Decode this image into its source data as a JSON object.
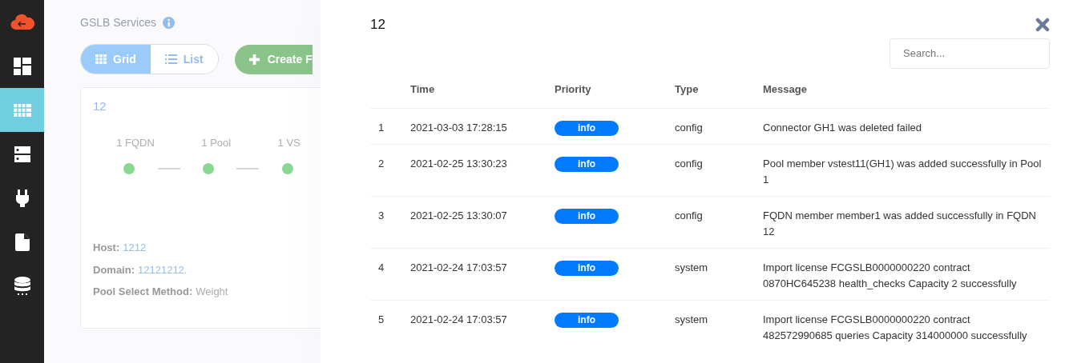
{
  "sidebar": {
    "items": [
      {
        "kind": "logo"
      },
      {
        "kind": "dashboard",
        "selected": false
      },
      {
        "kind": "grid",
        "selected": true
      },
      {
        "kind": "server",
        "selected": false
      },
      {
        "kind": "plug",
        "selected": false
      },
      {
        "kind": "file",
        "selected": false
      },
      {
        "kind": "database",
        "selected": false
      }
    ]
  },
  "page": {
    "title": "GSLB Services",
    "view_toggle": [
      {
        "label": "Grid",
        "kind": "grid",
        "selected": true
      },
      {
        "label": "List",
        "kind": "list",
        "selected": false
      }
    ],
    "create_button": "Create F"
  },
  "service_card": {
    "title": "12",
    "stats": [
      "1 FQDN",
      "1 Pool",
      "1 VS"
    ],
    "details": [
      {
        "label": "Host:",
        "value": "1212"
      },
      {
        "label": "Domain:",
        "value": "12121212."
      },
      {
        "label": "Pool Select Method:",
        "value": "Weight"
      }
    ]
  },
  "drawer": {
    "title": "12",
    "search": {
      "placeholder": "Search..."
    },
    "table": {
      "columns": [
        "Time",
        "Priority",
        "Type",
        "Message"
      ],
      "rows": [
        {
          "index": "1",
          "time": "2021-03-03 17:28:15",
          "priority": "info",
          "type": "config",
          "message": "Connector GH1 was deleted failed"
        },
        {
          "index": "2",
          "time": "2021-02-25 13:30:23",
          "priority": "info",
          "type": "config",
          "message": "Pool member vstest11(GH1) was added successfully in Pool 1"
        },
        {
          "index": "3",
          "time": "2021-02-25 13:30:07",
          "priority": "info",
          "type": "config",
          "message": "FQDN member member1 was added successfully in FQDN 12"
        },
        {
          "index": "4",
          "time": "2021-02-24 17:03:57",
          "priority": "info",
          "type": "system",
          "message": "Import license FCGSLB0000000220 contract 0870HC645238 health_checks Capacity 2 successfully"
        },
        {
          "index": "5",
          "time": "2021-02-24 17:03:57",
          "priority": "info",
          "type": "system",
          "message": "Import license FCGSLB0000000220 contract 482572990685 queries Capacity 314000000 successfully"
        }
      ]
    }
  }
}
